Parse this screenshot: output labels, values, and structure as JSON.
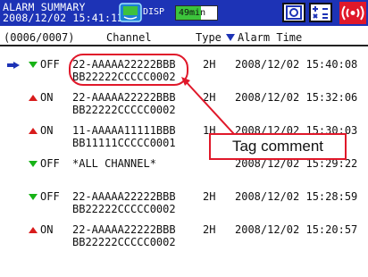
{
  "header": {
    "title_line1": "ALARM SUMMARY",
    "title_line2": "2008/12/02 15:41:13",
    "disp_label": "DISP",
    "timer_label": "49min",
    "timer_fill": 0.6,
    "icons": [
      "monitor-icon",
      "display-mode-icon",
      "math-icon",
      "alarm-sound-icon"
    ]
  },
  "table": {
    "count": "(0006/0007)",
    "col_channel": "Channel",
    "col_type": "Type",
    "col_time": "Alarm Time",
    "rows": [
      {
        "state": "OFF",
        "ch_line1": "22-AAAAA22222BBB",
        "ch_line2": "BB22222CCCCC0002",
        "type": "2H",
        "time": "2008/12/02 15:40:08",
        "selected": true
      },
      {
        "state": "ON",
        "ch_line1": "22-AAAAA22222BBB",
        "ch_line2": "BB22222CCCCC0002",
        "type": "2H",
        "time": "2008/12/02 15:32:06"
      },
      {
        "state": "ON",
        "ch_line1": "11-AAAAA11111BBB",
        "ch_line2": "BB11111CCCCC0001",
        "type": "1H",
        "time": "2008/12/02 15:30:03"
      },
      {
        "state": "OFF",
        "ch_line1": "*ALL CHANNEL*",
        "ch_line2": "",
        "type": "",
        "time": "2008/12/02 15:29:22"
      },
      {
        "state": "OFF",
        "ch_line1": "22-AAAAA22222BBB",
        "ch_line2": "BB22222CCCCC0002",
        "type": "2H",
        "time": "2008/12/02 15:28:59"
      },
      {
        "state": "ON",
        "ch_line1": "22-AAAAA22222BBB",
        "ch_line2": "BB22222CCCCC0002",
        "type": "2H",
        "time": "2008/12/02 15:20:57"
      }
    ]
  },
  "annotation": {
    "callout_text": "Tag comment"
  },
  "colors": {
    "header_bg": "#1d33b6",
    "on_red": "#d81c1c",
    "off_green": "#17b316",
    "cursor_blue": "#1d33b6",
    "annotation_red": "#e0182a"
  }
}
